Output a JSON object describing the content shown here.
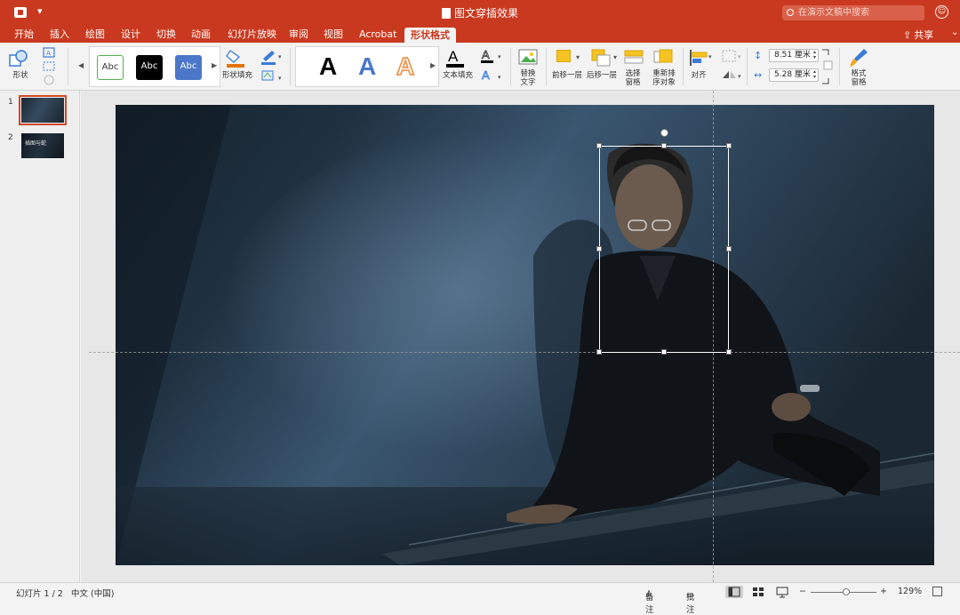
{
  "window": {
    "doc_title": "图文穿插效果",
    "search_placeholder": "在演示文稿中搜索",
    "qa_dropdown": "▾"
  },
  "tabs": [
    {
      "label": "开始"
    },
    {
      "label": "插入"
    },
    {
      "label": "绘图"
    },
    {
      "label": "设计"
    },
    {
      "label": "切换"
    },
    {
      "label": "动画"
    },
    {
      "label": "幻灯片放映"
    },
    {
      "label": "审阅"
    },
    {
      "label": "视图"
    },
    {
      "label": "Acrobat"
    },
    {
      "label": "形状格式",
      "active": true
    }
  ],
  "share": {
    "label": "共享"
  },
  "ribbon": {
    "shape_label": "形状",
    "shape_style_text": "Abc",
    "shape_fill_label": "形状填充",
    "wordart_glyph": "A",
    "text_fill_label": "文本填充",
    "alt_text_label": "替换\n文字",
    "bring_forward_label": "前移一层",
    "send_backward_label": "后移一层",
    "selection_pane_label": "选择\n窗格",
    "reorder_label": "重新排\n序对象",
    "align_label": "对齐",
    "height_value": "8.51 厘米",
    "width_value": "5.28 厘米",
    "format_pane_label": "格式\n窗格"
  },
  "slides": [
    {
      "number": "1",
      "selected": true
    },
    {
      "number": "2",
      "thumb_text": "插图与蛇"
    }
  ],
  "status": {
    "slide_counter": "幻灯片 1 / 2",
    "language": "中文 (中国)",
    "notes_label": "备注",
    "comments_label": "批注",
    "zoom_level": "129%",
    "zoom_minus": "−",
    "zoom_plus": "+"
  },
  "colors": {
    "accent": "#c9391f",
    "selection_outline": "#d04a2a"
  }
}
